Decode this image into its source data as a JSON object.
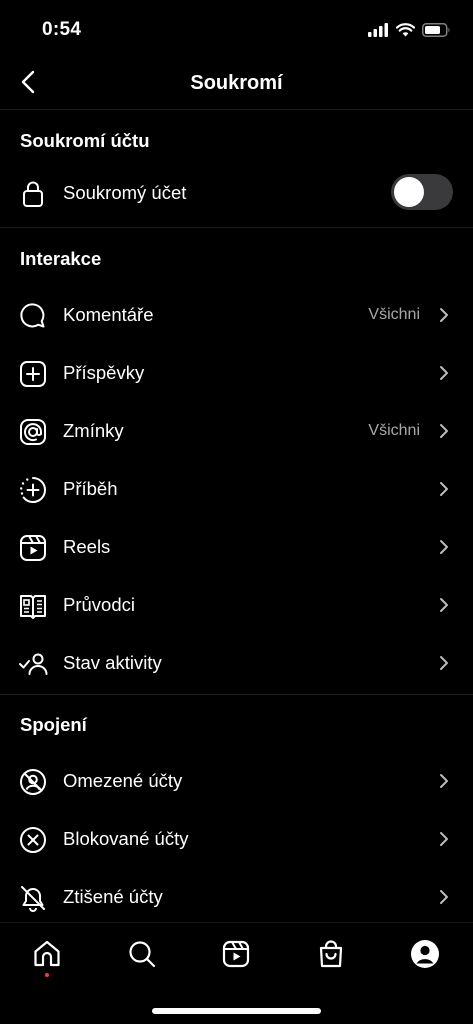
{
  "status_bar": {
    "time": "0:54",
    "icons": [
      "signal-icon",
      "wifi-icon",
      "battery-icon"
    ]
  },
  "nav": {
    "title": "Soukromí",
    "back_icon": "chevron-left-icon"
  },
  "account_section": {
    "header": "Soukromí účtu",
    "private_account": {
      "label": "Soukromý účet",
      "icon": "lock-icon",
      "enabled": false
    }
  },
  "interactions_section": {
    "header": "Interakce",
    "items": [
      {
        "label": "Komentáře",
        "value": "Všichni",
        "icon": "comment-icon"
      },
      {
        "label": "Příspěvky",
        "value": "",
        "icon": "plus-square-icon"
      },
      {
        "label": "Zmínky",
        "value": "Všichni",
        "icon": "at-sign-icon"
      },
      {
        "label": "Příběh",
        "value": "",
        "icon": "story-plus-icon"
      },
      {
        "label": "Reels",
        "value": "",
        "icon": "reels-icon"
      },
      {
        "label": "Průvodci",
        "value": "",
        "icon": "guides-icon"
      },
      {
        "label": "Stav aktivity",
        "value": "",
        "icon": "activity-status-icon"
      }
    ]
  },
  "connections_section": {
    "header": "Spojení",
    "items": [
      {
        "label": "Omezené účty",
        "icon": "restricted-icon"
      },
      {
        "label": "Blokované účty",
        "icon": "blocked-icon"
      },
      {
        "label": "Ztišené účty",
        "icon": "muted-bell-icon"
      }
    ]
  },
  "tab_bar": {
    "tabs": [
      "home-icon",
      "search-icon",
      "reels-icon",
      "shop-icon",
      "profile-icon"
    ],
    "accent_color": "#ff3040"
  }
}
